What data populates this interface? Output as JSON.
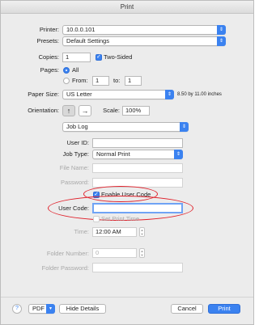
{
  "window": {
    "title": "Print"
  },
  "printer": {
    "label": "Printer:",
    "value": "10.0.0.101"
  },
  "presets": {
    "label": "Presets:",
    "value": "Default Settings"
  },
  "copies": {
    "label": "Copies:",
    "value": "1",
    "two_sided_label": "Two-Sided",
    "two_sided_checked": true
  },
  "pages": {
    "label": "Pages:",
    "all_label": "All",
    "from_label": "From:",
    "from_value": "1",
    "to_label": "to:",
    "to_value": "1",
    "selected": "All"
  },
  "paper_size": {
    "label": "Paper Size:",
    "value": "US Letter",
    "dimensions": "8.50 by 11.00 inches"
  },
  "orientation": {
    "label": "Orientation:",
    "scale_label": "Scale:",
    "scale_value": "100%"
  },
  "section_popup": {
    "value": "Job Log"
  },
  "job_log": {
    "user_id_label": "User ID:",
    "user_id_value": "",
    "job_type_label": "Job Type:",
    "job_type_value": "Normal Print",
    "file_name_label": "File Name:",
    "password_label": "Password:",
    "enable_user_code_label": "Enable User Code",
    "enable_user_code_checked": true,
    "user_code_label": "User Code:",
    "user_code_value": "",
    "set_print_time_label": "Set Print Time",
    "time_label": "Time:",
    "time_value": "12:00 AM",
    "folder_number_label": "Folder Number:",
    "folder_number_value": "0",
    "folder_password_label": "Folder Password:"
  },
  "footer": {
    "help_label": "?",
    "pdf_label": "PDF",
    "hide_details_label": "Hide Details",
    "cancel_label": "Cancel",
    "print_label": "Print"
  },
  "colors": {
    "accent": "#3b82f0",
    "annotation": "#e0202a"
  }
}
